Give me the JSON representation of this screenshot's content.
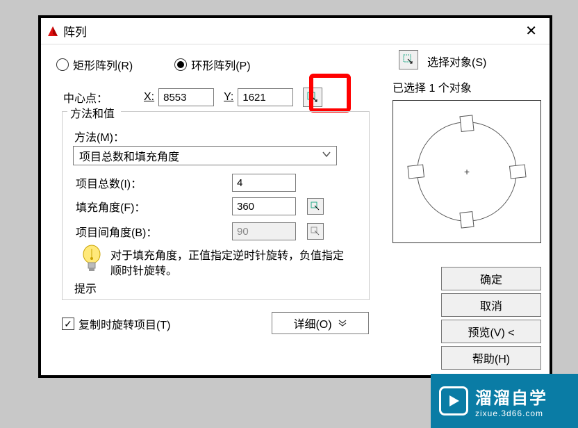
{
  "title": "阵列",
  "close_icon": "✕",
  "radios": {
    "rect": "矩形阵列(R)",
    "polar": "环形阵列(P)"
  },
  "select_object": "选择对象(S)",
  "status": "已选择 1 个对象",
  "center": {
    "label": "中心点：",
    "x_label": "X:",
    "x_value": "8553",
    "y_label": "Y:",
    "y_value": "1621"
  },
  "method": {
    "group_title": "方法和值",
    "label": "方法(M)：",
    "selected": "项目总数和填充角度"
  },
  "params": {
    "total": {
      "label": "项目总数(I)：",
      "value": "4"
    },
    "fill": {
      "label": "填充角度(F)：",
      "value": "360"
    },
    "between": {
      "label": "项目间角度(B)：",
      "value": "90"
    }
  },
  "hint": {
    "text": "对于填充角度，正值指定逆时针旋转，负值指定顺时针旋转。",
    "label": "提示"
  },
  "copy_rotate": "复制时旋转项目(T)",
  "detail": "详细(O)",
  "buttons": {
    "ok": "确定",
    "cancel": "取消",
    "preview": "预览(V) <",
    "help": "帮助(H)"
  },
  "watermark": {
    "brand": "溜溜自学",
    "url": "zixue.3d66.com"
  }
}
